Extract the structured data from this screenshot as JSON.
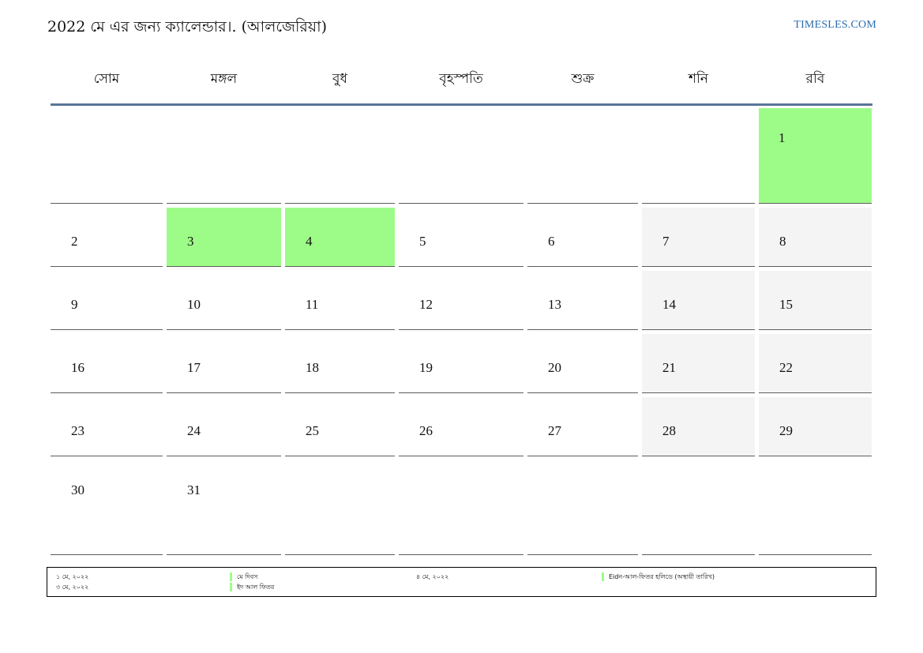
{
  "header": {
    "title": "2022 মে এর জন্য ক্যালেন্ডার।. (আলজেরিয়া)",
    "brand": "TIMESLES.COM"
  },
  "weekdays": [
    "সোম",
    "মঙ্গল",
    "বুধ",
    "বৃহস্পতি",
    "শুক্র",
    "শনি",
    "রবি"
  ],
  "days": [
    "1",
    "2",
    "3",
    "4",
    "5",
    "6",
    "7",
    "8",
    "9",
    "10",
    "11",
    "12",
    "13",
    "14",
    "15",
    "16",
    "17",
    "18",
    "19",
    "20",
    "21",
    "22",
    "23",
    "24",
    "25",
    "26",
    "27",
    "28",
    "29",
    "30",
    "31"
  ],
  "colors": {
    "holiday": "#9dfc88",
    "weekend": "#f4f4f4",
    "header_rule": "#5a7599",
    "brand": "#2a6db0"
  },
  "legend": {
    "items": [
      {
        "date": "১ মে, ২০২২",
        "name": "মে দিবস"
      },
      {
        "date": "৩ মে, ২০২২",
        "name": "ইদ আল ফিতর"
      },
      {
        "date": "৪ মে, ২০২২",
        "name": "Eidন-আল-ফিতর হলিডে (অস্থায়ী তারিখ)"
      }
    ]
  }
}
